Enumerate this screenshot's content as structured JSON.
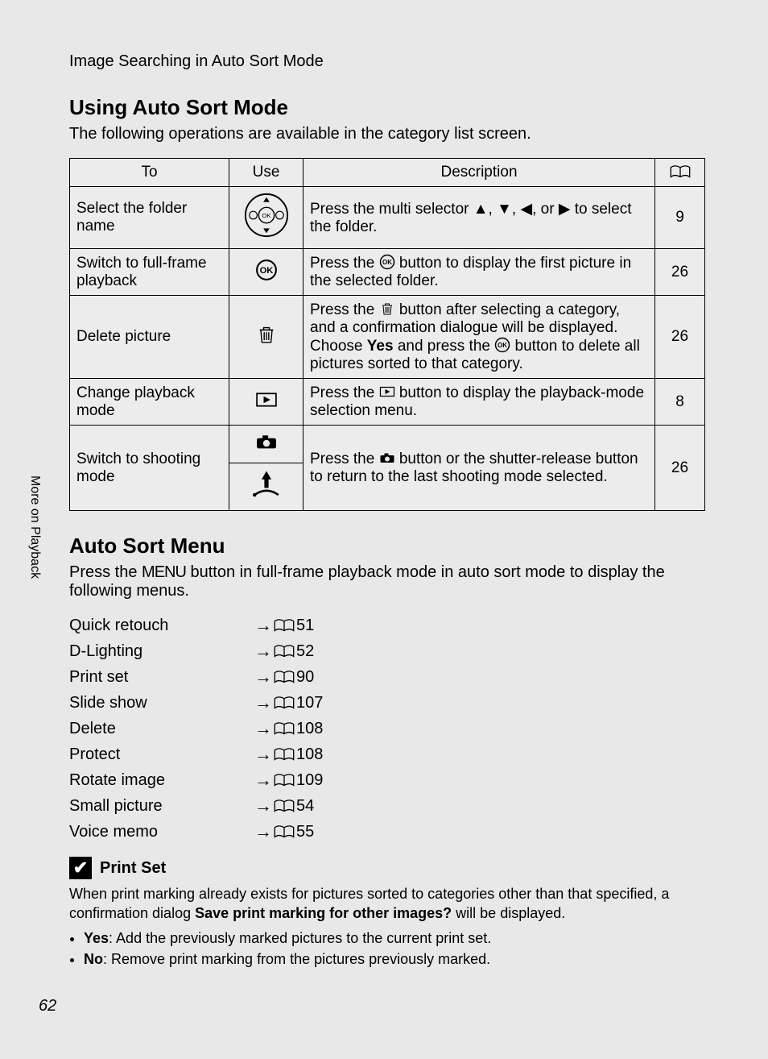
{
  "breadcrumb": "Image Searching in Auto Sort Mode",
  "heading1": "Using Auto Sort Mode",
  "intro1": "The following operations are available in the category list screen.",
  "table_headers": {
    "to": "To",
    "use": "Use",
    "desc": "Description",
    "ref_icon": "book"
  },
  "rows": [
    {
      "to": "Select the folder name",
      "use_icon": "multi-selector",
      "desc_pre": "Press the multi selector ",
      "desc_post": " to select the folder.",
      "desc_glyphs": "▲, ▼, ◀, or ▶",
      "ref": "9"
    },
    {
      "to": "Switch to full-frame playback",
      "use_icon": "ok-ring",
      "desc_pre": "Press the ",
      "desc_mid": " button to display the first picture in the selected folder.",
      "ref": "26"
    },
    {
      "to": "Delete picture",
      "use_icon": "trash",
      "desc_pre": "Press the ",
      "desc_mid1": " button after selecting a category, and a confirmation dialogue will be displayed. Choose ",
      "desc_bold": "Yes",
      "desc_mid2": " and press the ",
      "desc_post": " button to delete all pictures sorted to that category.",
      "ref": "26"
    },
    {
      "to": "Change playback mode",
      "use_icon": "play-rect",
      "desc_pre": "Press the ",
      "desc_post": " button to display the playback-mode selection menu.",
      "ref": "8"
    },
    {
      "to": "Switch to shooting mode",
      "use_icon_a": "camera",
      "use_icon_b": "shutter",
      "desc_pre": "Press the ",
      "desc_post": " button or the shutter-release button to return to the last shooting mode selected.",
      "ref": "26"
    }
  ],
  "heading2": "Auto Sort Menu",
  "intro2_pre": "Press the ",
  "intro2_menu": "MENU",
  "intro2_post": " button in full-frame playback mode in auto sort mode to display the following menus.",
  "menu_items": [
    {
      "label": "Quick retouch",
      "ref": "51"
    },
    {
      "label": "D-Lighting",
      "ref": "52"
    },
    {
      "label": "Print set",
      "ref": "90"
    },
    {
      "label": "Slide show",
      "ref": "107"
    },
    {
      "label": "Delete",
      "ref": "108"
    },
    {
      "label": "Protect",
      "ref": "108"
    },
    {
      "label": "Rotate image",
      "ref": "109"
    },
    {
      "label": "Small picture",
      "ref": "54"
    },
    {
      "label": "Voice memo",
      "ref": "55"
    }
  ],
  "note": {
    "title": "Print Set",
    "body1_pre": "When print marking already exists for pictures sorted to categories other than that specified, a confirmation dialog ",
    "body1_bold": "Save print marking for other images?",
    "body1_post": " will be displayed.",
    "bullets": [
      {
        "lead": "Yes",
        "text": ": Add the previously marked pictures to the current print set."
      },
      {
        "lead": "No",
        "text": ": Remove print marking from the pictures previously marked."
      }
    ]
  },
  "side_tab": "More on Playback",
  "page_number": "62"
}
